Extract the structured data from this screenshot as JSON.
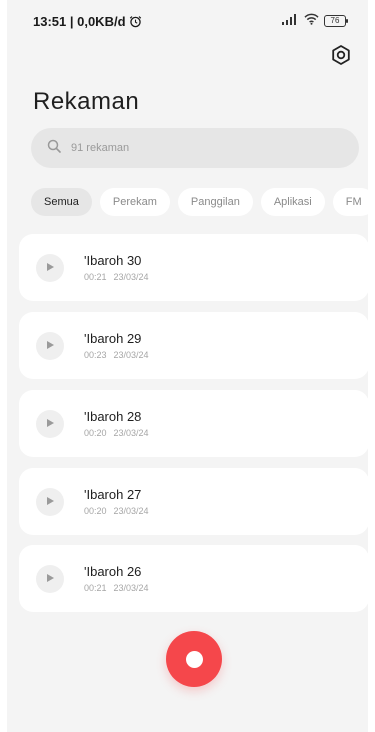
{
  "status_bar": {
    "time_speed": "13:51 | 0,0KB/d",
    "battery": "76"
  },
  "header": {
    "title": "Rekaman"
  },
  "search": {
    "placeholder": "91 rekaman"
  },
  "filters": [
    {
      "label": "Semua",
      "active": true
    },
    {
      "label": "Perekam",
      "active": false
    },
    {
      "label": "Panggilan",
      "active": false
    },
    {
      "label": "Aplikasi",
      "active": false
    },
    {
      "label": "FM",
      "active": false
    }
  ],
  "recordings": [
    {
      "title": "'Ibaroh 30",
      "duration": "00:21",
      "date": "23/03/24"
    },
    {
      "title": "'Ibaroh 29",
      "duration": "00:23",
      "date": "23/03/24"
    },
    {
      "title": "'Ibaroh 28",
      "duration": "00:20",
      "date": "23/03/24"
    },
    {
      "title": "'Ibaroh 27",
      "duration": "00:20",
      "date": "23/03/24"
    },
    {
      "title": "'Ibaroh 26",
      "duration": "00:21",
      "date": "23/03/24"
    }
  ],
  "colors": {
    "record": "#f5474b",
    "background": "#f4f4f4",
    "card": "#ffffff"
  },
  "icons": [
    "alarm-icon",
    "signal-icon",
    "wifi-icon",
    "battery-icon",
    "settings-icon",
    "search-icon",
    "play-icon",
    "record-icon"
  ]
}
